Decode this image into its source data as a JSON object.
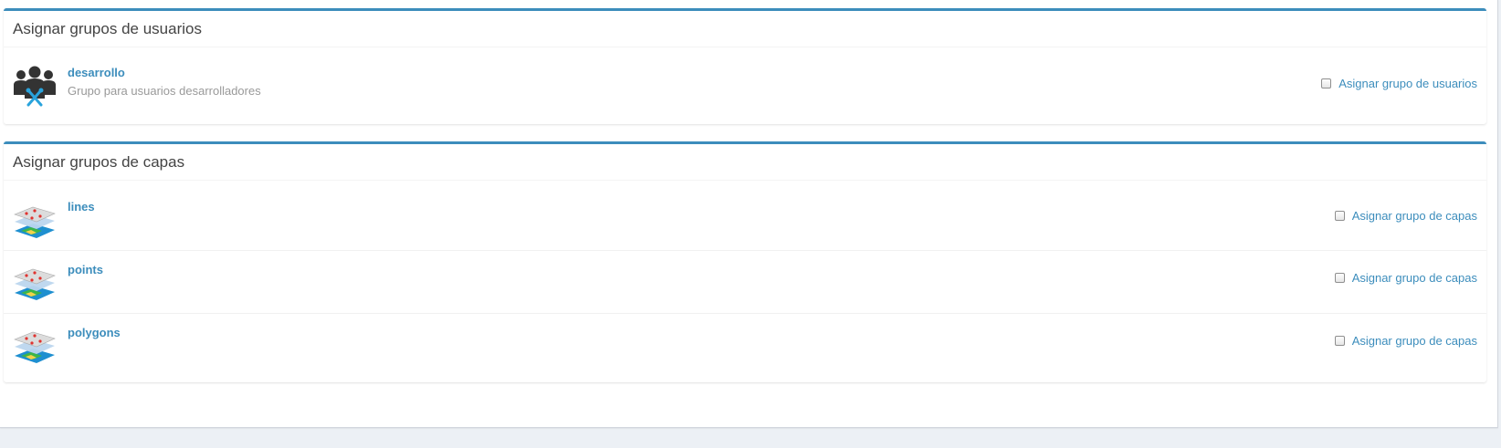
{
  "user_groups": {
    "title": "Asignar grupos de usuarios",
    "items": [
      {
        "name": "desarrollo",
        "description": "Grupo para usuarios desarrolladores",
        "assign_label": "Asignar grupo de usuarios",
        "checked": false,
        "icon": "users-tools-icon"
      }
    ]
  },
  "layer_groups": {
    "title": "Asignar grupos de capas",
    "items": [
      {
        "name": "lines",
        "assign_label": "Asignar grupo de capas",
        "checked": false,
        "icon": "map-layers-icon"
      },
      {
        "name": "points",
        "assign_label": "Asignar grupo de capas",
        "checked": false,
        "icon": "map-layers-icon"
      },
      {
        "name": "polygons",
        "assign_label": "Asignar grupo de capas",
        "checked": false,
        "icon": "map-layers-icon"
      }
    ]
  },
  "colors": {
    "accent": "#3c8dbc",
    "background": "#ecf0f5",
    "muted_text": "#999999"
  }
}
